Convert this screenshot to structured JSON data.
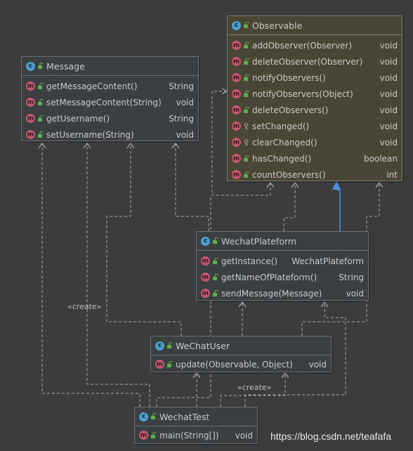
{
  "classes": {
    "message": {
      "name": "Message",
      "methods": [
        {
          "name": "getMessageContent()",
          "type": "String"
        },
        {
          "name": "setMessageContent(String)",
          "type": "void"
        },
        {
          "name": "getUsername()",
          "type": "String"
        },
        {
          "name": "setUsername(String)",
          "type": "void"
        }
      ]
    },
    "observable": {
      "name": "Observable",
      "methods": [
        {
          "name": "addObserver(Observer)",
          "type": "void",
          "visibility": "public"
        },
        {
          "name": "deleteObserver(Observer)",
          "type": "void",
          "visibility": "public"
        },
        {
          "name": "notifyObservers()",
          "type": "void",
          "visibility": "public"
        },
        {
          "name": "notifyObservers(Object)",
          "type": "void",
          "visibility": "public"
        },
        {
          "name": "deleteObservers()",
          "type": "void",
          "visibility": "public"
        },
        {
          "name": "setChanged()",
          "type": "void",
          "visibility": "protected"
        },
        {
          "name": "clearChanged()",
          "type": "void",
          "visibility": "protected"
        },
        {
          "name": "hasChanged()",
          "type": "boolean",
          "visibility": "public"
        },
        {
          "name": "countObservers()",
          "type": "int",
          "visibility": "public"
        }
      ]
    },
    "wechatPlateform": {
      "name": "WechatPlateform",
      "methods": [
        {
          "name": "getInstance()",
          "type": "WechatPlateform"
        },
        {
          "name": "getNameOfPlateform()",
          "type": "String"
        },
        {
          "name": "sendMessage(Message)",
          "type": "void"
        }
      ]
    },
    "wechatUser": {
      "name": "WeChatUser",
      "methods": [
        {
          "name": "update(Observable, Object)",
          "type": "void"
        }
      ]
    },
    "wechatTest": {
      "name": "WechatTest",
      "methods": [
        {
          "name": "main(String[])",
          "type": "void"
        }
      ]
    }
  },
  "labels": {
    "create_left": "«create»",
    "create_bottom": "«create»"
  },
  "icons": {
    "class_badge": "class-icon",
    "method_badge": "method-icon",
    "public_marker": "unlocked-icon",
    "protected_marker": "key-icon"
  },
  "colors": {
    "background": "#3b3c3e",
    "dependency_line": "#a9a9a9",
    "inheritance_line": "#4a90e2",
    "class_badge": "#4a9fcf",
    "method_badge": "#c4566d",
    "visibility_public": "#5fae4c"
  },
  "watermark": "https://blog.csdn.net/teafafa"
}
